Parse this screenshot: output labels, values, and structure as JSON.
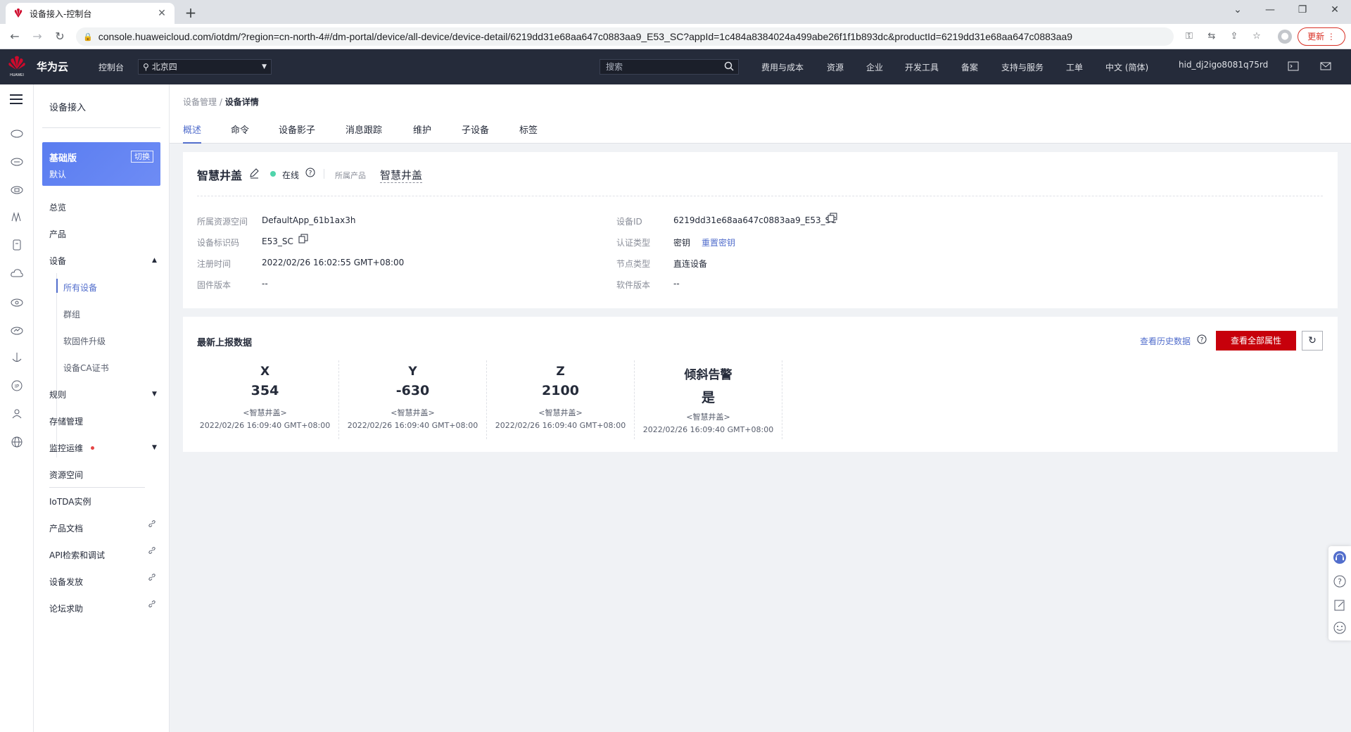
{
  "browser": {
    "tab_title": "设备接入-控制台",
    "url": "console.huaweicloud.com/iotdm/?region=cn-north-4#/dm-portal/device/all-device/device-detail/6219dd31e68aa647c0883aa9_E53_SC?appId=1c484a8384024a499abe26f1f1b893dc&productId=6219dd31e68aa647c0883aa9",
    "update_label": "更新"
  },
  "topnav": {
    "brand": "华为云",
    "console": "控制台",
    "region": "北京四",
    "search_placeholder": "搜索",
    "items": [
      "费用与成本",
      "资源",
      "企业",
      "开发工具",
      "备案",
      "支持与服务",
      "工单",
      "中文 (简体)"
    ],
    "user": "hid_dj2igo8081q75rd"
  },
  "sidebar": {
    "title": "设备接入",
    "edition": "基础版",
    "edition_sub": "默认",
    "switch_label": "切换",
    "items": {
      "overview": "总览",
      "product": "产品",
      "device": "设备",
      "all_devices": "所有设备",
      "group": "群组",
      "firmware": "软固件升级",
      "ca_cert": "设备CA证书",
      "rules": "规则",
      "storage": "存储管理",
      "monitor": "监控运维",
      "resource_space": "资源空间",
      "iotda_instance": "IoTDA实例",
      "product_docs": "产品文档",
      "api_explorer": "API检索和调试",
      "device_provision": "设备发放",
      "forum": "论坛求助"
    }
  },
  "breadcrumb": {
    "parent": "设备管理",
    "sep": "/",
    "current": "设备详情"
  },
  "tabs": [
    "概述",
    "命令",
    "设备影子",
    "消息跟踪",
    "维护",
    "子设备",
    "标签"
  ],
  "device": {
    "name": "智慧井盖",
    "status": "在线",
    "product_label": "所属产品",
    "product": "智慧井盖",
    "fields": {
      "space_label": "所属资源空间",
      "space": "DefaultApp_61b1ax3h",
      "ident_label": "设备标识码",
      "ident": "E53_SC",
      "reg_label": "注册时间",
      "reg": "2022/02/26 16:02:55 GMT+08:00",
      "fw_label": "固件版本",
      "fw": "--",
      "id_label": "设备ID",
      "id": "6219dd31e68aa647c0883aa9_E53_SC",
      "auth_label": "认证类型",
      "auth": "密钥",
      "reset_key": "重置密钥",
      "node_label": "节点类型",
      "node": "直连设备",
      "sw_label": "软件版本",
      "sw": "--"
    }
  },
  "latest": {
    "title": "最新上报数据",
    "history_link": "查看历史数据",
    "all_props_btn": "查看全部属性",
    "metrics": [
      {
        "name": "X",
        "value": "354",
        "product": "<智慧井盖>",
        "time": "2022/02/26 16:09:40 GMT+08:00"
      },
      {
        "name": "Y",
        "value": "-630",
        "product": "<智慧井盖>",
        "time": "2022/02/26 16:09:40 GMT+08:00"
      },
      {
        "name": "Z",
        "value": "2100",
        "product": "<智慧井盖>",
        "time": "2022/02/26 16:09:40 GMT+08:00"
      },
      {
        "name": "倾斜告警",
        "value": "是",
        "product": "<智慧井盖>",
        "time": "2022/02/26 16:09:40 GMT+08:00"
      }
    ]
  },
  "colors": {
    "accent": "#526ecc",
    "brand_red": "#c7000b",
    "online": "#50d4ab",
    "nav_bg": "#252b3a"
  }
}
